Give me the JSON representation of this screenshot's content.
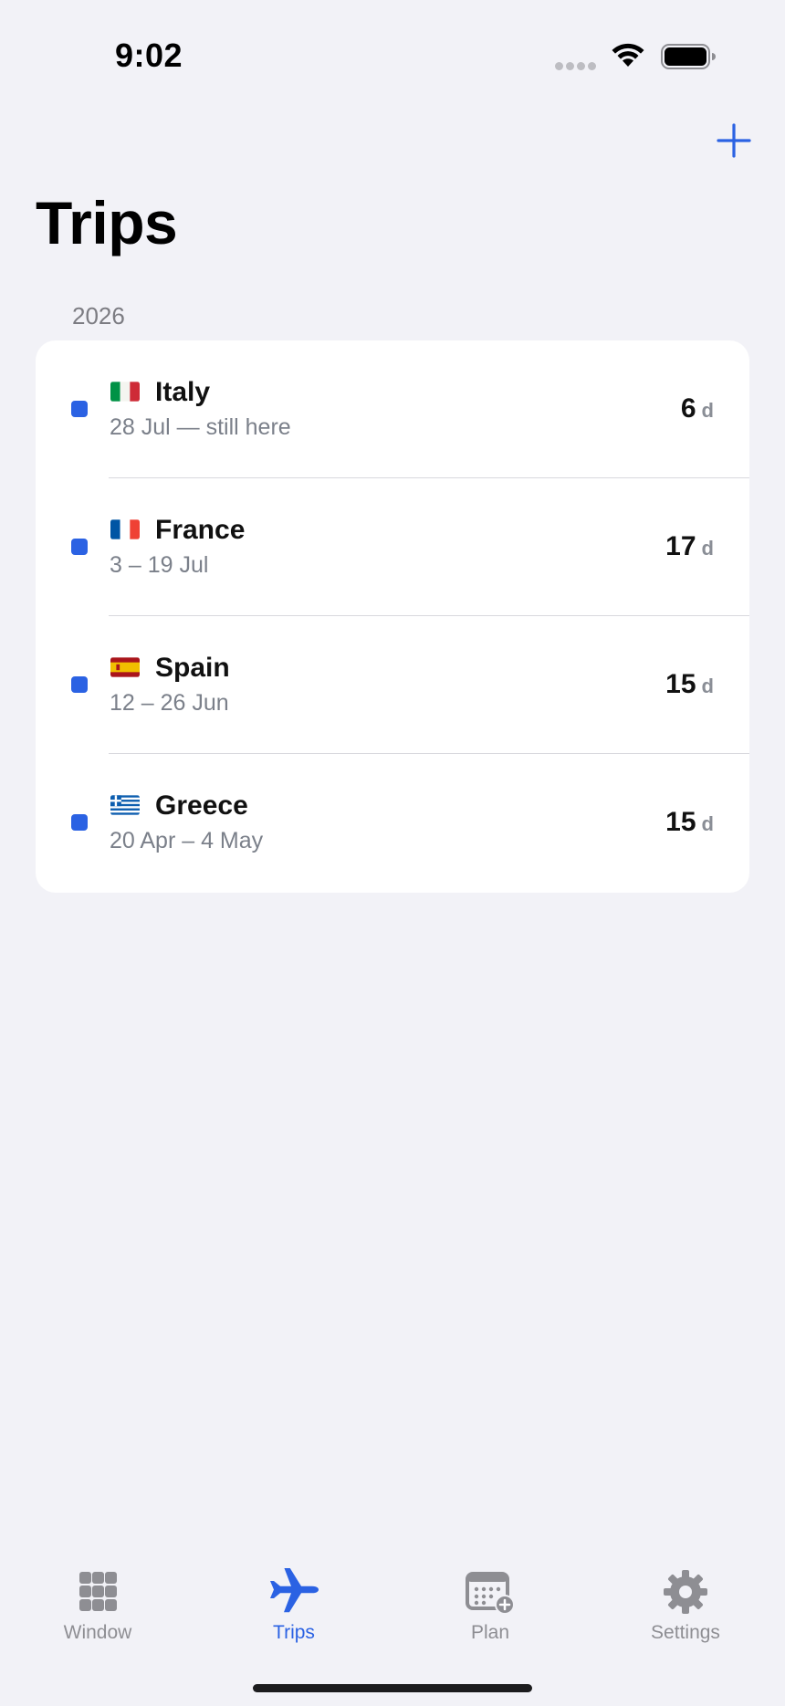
{
  "status_bar": {
    "time": "9:02"
  },
  "header": {
    "title": "Trips",
    "add_icon": "plus-icon"
  },
  "colors": {
    "accent": "#2b62e3",
    "marker": "#2b62e3"
  },
  "section": {
    "year": "2026"
  },
  "trips": [
    {
      "flag": "italy-flag",
      "country": "Italy",
      "dates": "28 Jul — still here",
      "days": "6",
      "unit": "d"
    },
    {
      "flag": "france-flag",
      "country": "France",
      "dates": "3 – 19 Jul",
      "days": "17",
      "unit": "d"
    },
    {
      "flag": "spain-flag",
      "country": "Spain",
      "dates": "12 – 26 Jun",
      "days": "15",
      "unit": "d"
    },
    {
      "flag": "greece-flag",
      "country": "Greece",
      "dates": "20 Apr – 4 May",
      "days": "15",
      "unit": "d"
    }
  ],
  "tabs": [
    {
      "label": "Window",
      "icon": "grid-icon",
      "active": false
    },
    {
      "label": "Trips",
      "icon": "airplane-icon",
      "active": true
    },
    {
      "label": "Plan",
      "icon": "calendar-add-icon",
      "active": false
    },
    {
      "label": "Settings",
      "icon": "gear-icon",
      "active": false
    }
  ]
}
